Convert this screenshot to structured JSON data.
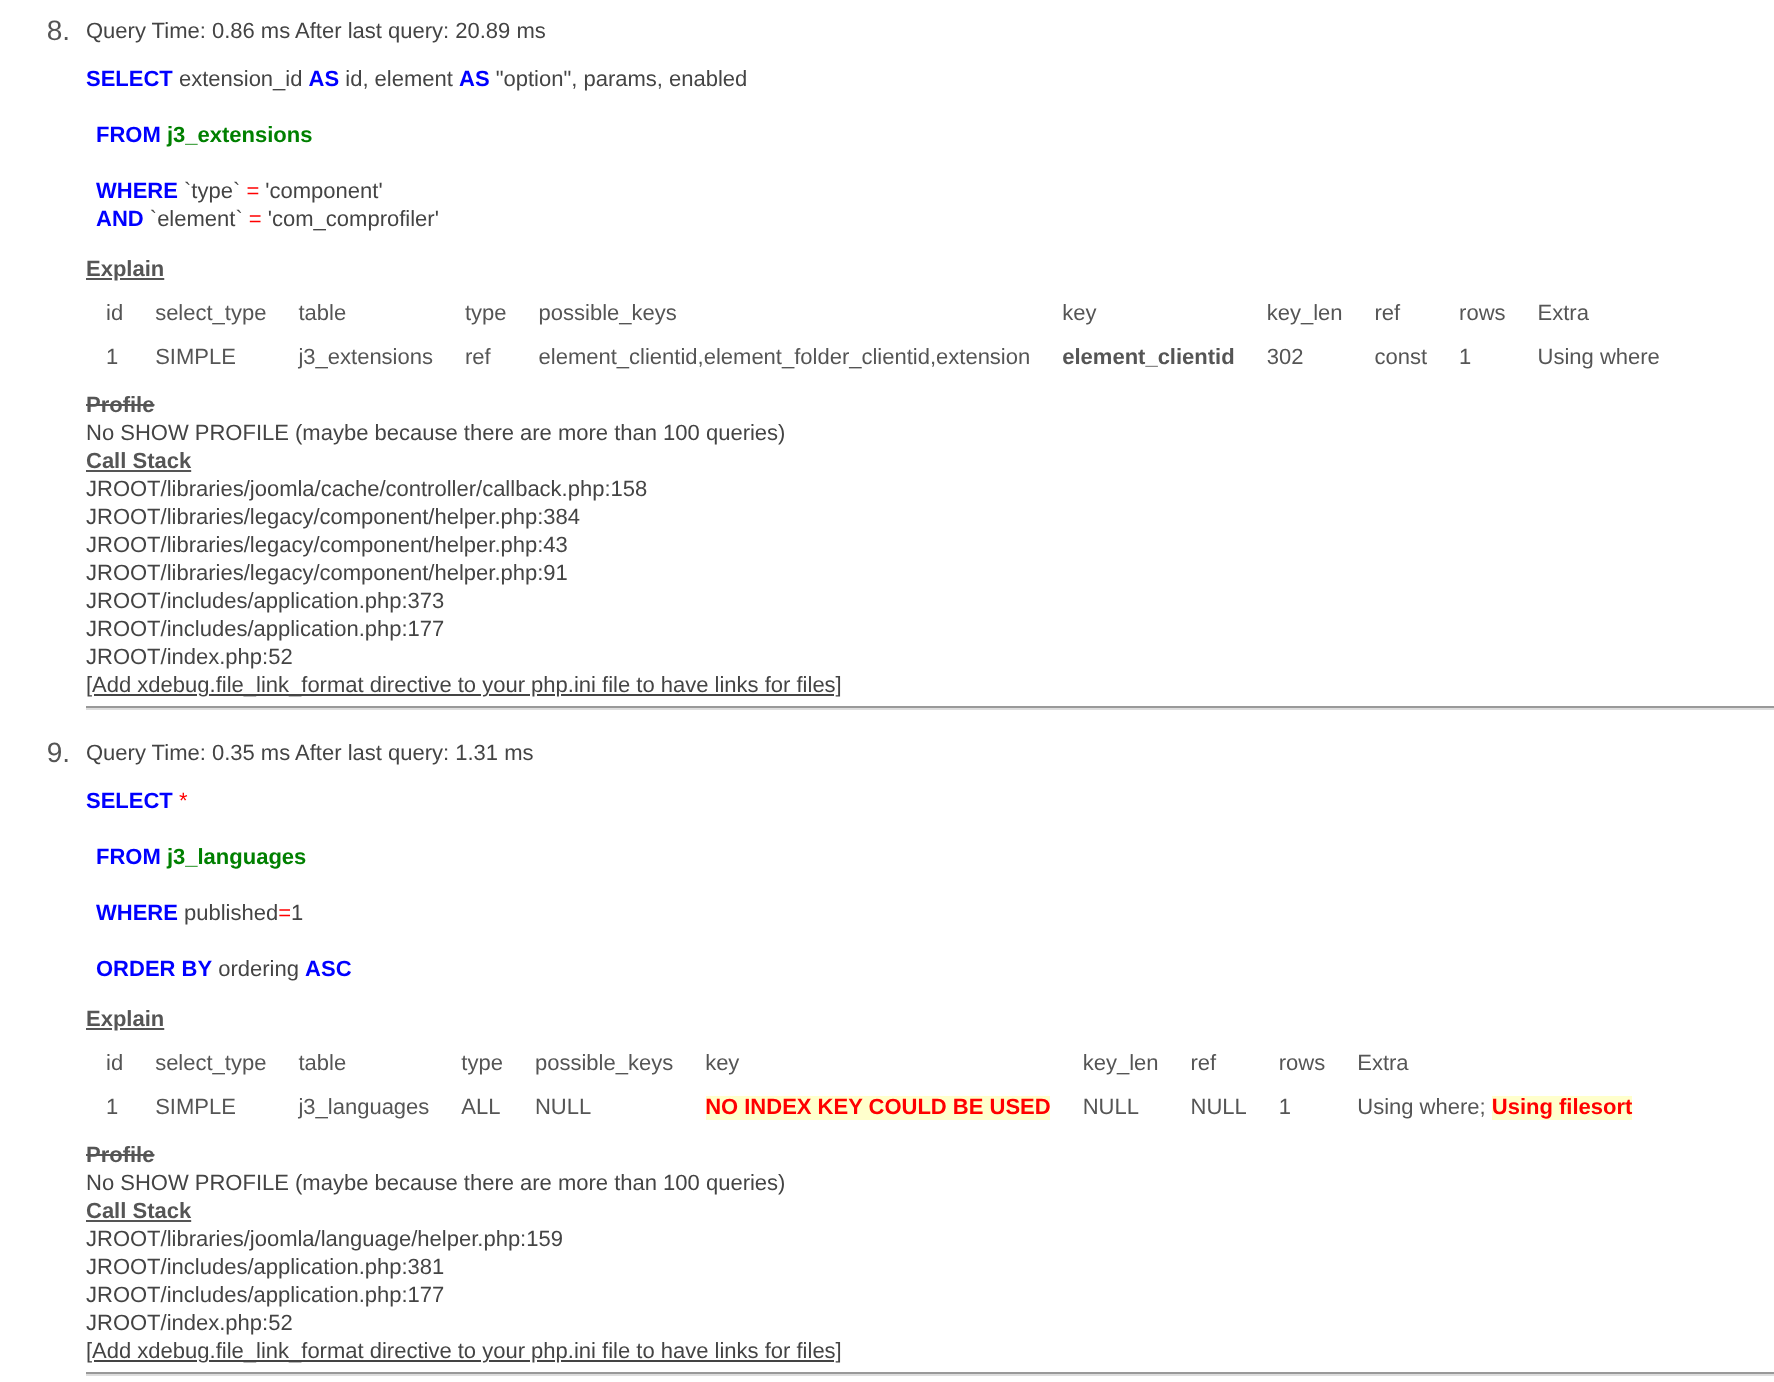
{
  "queries": [
    {
      "number": "8.",
      "header": "Query Time: 0.86 ms After last query: 20.89 ms",
      "sql": [
        {
          "kind": "head",
          "lines": [
            [
              {
                "text": "SELECT",
                "kind": "keyword"
              },
              {
                "text": " extension_id ",
                "kind": "plain"
              },
              {
                "text": "AS",
                "kind": "keyword"
              },
              {
                "text": " id, element ",
                "kind": "plain"
              },
              {
                "text": "AS",
                "kind": "keyword"
              },
              {
                "text": " \"option\", params, enabled",
                "kind": "plain"
              }
            ]
          ]
        },
        {
          "kind": "clause",
          "lines": [
            [
              {
                "text": "FROM",
                "kind": "keyword"
              },
              {
                "text": " j3_extensions",
                "kind": "table"
              }
            ]
          ]
        },
        {
          "kind": "clause",
          "lines": [
            [
              {
                "text": "WHERE",
                "kind": "keyword"
              },
              {
                "text": " `type` ",
                "kind": "plain"
              },
              {
                "text": "=",
                "kind": "operator"
              },
              {
                "text": " 'component'",
                "kind": "plain"
              }
            ],
            [
              {
                "text": "AND",
                "kind": "keyword"
              },
              {
                "text": " `element` ",
                "kind": "plain"
              },
              {
                "text": "=",
                "kind": "operator"
              },
              {
                "text": " 'com_comprofiler'",
                "kind": "plain"
              }
            ]
          ]
        }
      ],
      "explain_title": "Explain",
      "columns": [
        "id",
        "select_type",
        "table",
        "type",
        "possible_keys",
        "key",
        "key_len",
        "ref",
        "rows",
        "Extra"
      ],
      "rows": [
        [
          [
            {
              "text": "1",
              "kind": "plain"
            }
          ],
          [
            {
              "text": "SIMPLE",
              "kind": "plain"
            }
          ],
          [
            {
              "text": "j3_extensions",
              "kind": "plain"
            }
          ],
          [
            {
              "text": "ref",
              "kind": "plain"
            }
          ],
          [
            {
              "text": "element_clientid,element_folder_clientid,extension",
              "kind": "plain"
            }
          ],
          [
            {
              "text": "element_clientid",
              "kind": "bold"
            }
          ],
          [
            {
              "text": "302",
              "kind": "plain"
            }
          ],
          [
            {
              "text": "const",
              "kind": "plain"
            }
          ],
          [
            {
              "text": "1",
              "kind": "plain"
            }
          ],
          [
            {
              "text": "Using where",
              "kind": "plain"
            }
          ]
        ]
      ],
      "profile_title": "Profile",
      "profile_text": "No SHOW PROFILE (maybe because there are more than 100 queries)",
      "stack_title": "Call Stack",
      "stack": [
        "JROOT/libraries/joomla/cache/controller/callback.php:158",
        "JROOT/libraries/legacy/component/helper.php:384",
        "JROOT/libraries/legacy/component/helper.php:43",
        "JROOT/libraries/legacy/component/helper.php:91",
        "JROOT/includes/application.php:373",
        "JROOT/includes/application.php:177",
        "JROOT/index.php:52"
      ],
      "link": "[Add xdebug.file_link_format directive to your php.ini file to have links for files]"
    },
    {
      "number": "9.",
      "header": "Query Time: 0.35 ms After last query: 1.31 ms",
      "sql": [
        {
          "kind": "head",
          "lines": [
            [
              {
                "text": "SELECT",
                "kind": "keyword"
              },
              {
                "text": " *",
                "kind": "operator"
              }
            ]
          ]
        },
        {
          "kind": "clause",
          "lines": [
            [
              {
                "text": "FROM",
                "kind": "keyword"
              },
              {
                "text": " j3_languages",
                "kind": "table"
              }
            ]
          ]
        },
        {
          "kind": "clause",
          "lines": [
            [
              {
                "text": "WHERE",
                "kind": "keyword"
              },
              {
                "text": " published",
                "kind": "plain"
              },
              {
                "text": "=",
                "kind": "operator"
              },
              {
                "text": "1",
                "kind": "plain"
              }
            ]
          ]
        },
        {
          "kind": "clause",
          "lines": [
            [
              {
                "text": "ORDER BY",
                "kind": "keyword"
              },
              {
                "text": " ordering ",
                "kind": "plain"
              },
              {
                "text": "ASC",
                "kind": "keyword"
              }
            ]
          ]
        }
      ],
      "explain_title": "Explain",
      "columns": [
        "id",
        "select_type",
        "table",
        "type",
        "possible_keys",
        "key",
        "key_len",
        "ref",
        "rows",
        "Extra"
      ],
      "rows": [
        [
          [
            {
              "text": "1",
              "kind": "plain"
            }
          ],
          [
            {
              "text": "SIMPLE",
              "kind": "plain"
            }
          ],
          [
            {
              "text": "j3_languages",
              "kind": "plain"
            }
          ],
          [
            {
              "text": "ALL",
              "kind": "plain"
            }
          ],
          [
            {
              "text": "NULL",
              "kind": "plain"
            }
          ],
          [
            {
              "text": "NO INDEX KEY COULD BE USED",
              "kind": "warning"
            }
          ],
          [
            {
              "text": "NULL",
              "kind": "plain"
            }
          ],
          [
            {
              "text": "NULL",
              "kind": "plain"
            }
          ],
          [
            {
              "text": "1",
              "kind": "plain"
            }
          ],
          [
            {
              "text": "Using where; ",
              "kind": "plain"
            },
            {
              "text": "Using filesort",
              "kind": "warning"
            }
          ]
        ]
      ],
      "profile_title": "Profile",
      "profile_text": "No SHOW PROFILE (maybe because there are more than 100 queries)",
      "stack_title": "Call Stack",
      "stack": [
        "JROOT/libraries/joomla/language/helper.php:159",
        "JROOT/includes/application.php:381",
        "JROOT/includes/application.php:177",
        "JROOT/index.php:52"
      ],
      "link": "[Add xdebug.file_link_format directive to your php.ini file to have links for files]"
    }
  ]
}
